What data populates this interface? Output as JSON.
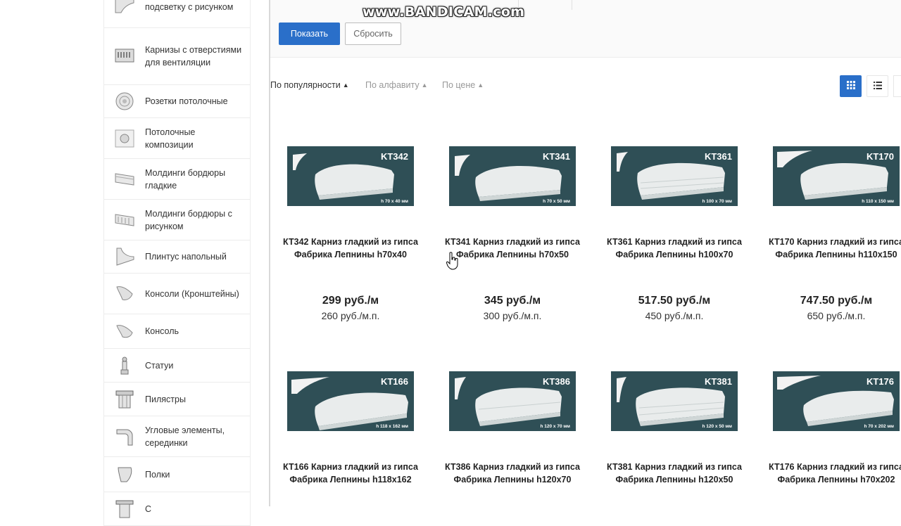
{
  "watermark": "www.BANDICAM.com",
  "sidebar": {
    "items": [
      {
        "label": "подсветку с рисунком",
        "icon": "cornice-pattern-icon"
      },
      {
        "label": "Карнизы с отверстиями для вентиляции",
        "icon": "vent-cornice-icon"
      },
      {
        "label": "Розетки потолочные",
        "icon": "ceiling-rosette-icon"
      },
      {
        "label": "Потолочные композиции",
        "icon": "ceiling-composition-icon"
      },
      {
        "label": "Молдинги бордюры гладкие",
        "icon": "molding-smooth-icon"
      },
      {
        "label": "Молдинги бордюры с рисунком",
        "icon": "molding-pattern-icon"
      },
      {
        "label": "Плинтус напольный",
        "icon": "baseboard-icon"
      },
      {
        "label": "Консоли (Кронштейны)",
        "icon": "bracket-icon"
      },
      {
        "label": "Консоль",
        "icon": "console-icon"
      },
      {
        "label": "Статуи",
        "icon": "statue-icon"
      },
      {
        "label": "Пилястры",
        "icon": "pilaster-icon"
      },
      {
        "label": "Угловые элементы, серединки",
        "icon": "corner-element-icon"
      },
      {
        "label": "Полки",
        "icon": "shelf-icon"
      },
      {
        "label": "С",
        "icon": "column-icon"
      }
    ]
  },
  "filter": {
    "show_label": "Показать",
    "reset_label": "Сбросить"
  },
  "sort": {
    "popularity": "По популярности",
    "alphabet": "По алфавиту",
    "price": "По цене",
    "active": "popularity"
  },
  "view": {
    "grid_icon": "grid-view-icon",
    "list_icon": "list-view-icon",
    "active": "grid"
  },
  "products": [
    {
      "code": "KT342",
      "dims": "h 70 x 40 мм",
      "name": "КТ342 Карниз гладкий из гипса Фабрика Лепнины h70x40",
      "price": "299 руб./м",
      "price_alt": "260 руб./м.п."
    },
    {
      "code": "KT341",
      "dims": "h 70 x 50 мм",
      "name": "КТ341 Карниз гладкий из гипса Фабрика Лепнины h70x50",
      "price": "345 руб./м",
      "price_alt": "300 руб./м.п."
    },
    {
      "code": "KT361",
      "dims": "h 100 x 70 мм",
      "name": "КТ361 Карниз гладкий из гипса Фабрика Лепнины h100x70",
      "price": "517.50 руб./м",
      "price_alt": "450 руб./м.п."
    },
    {
      "code": "KT170",
      "dims": "h 110 x 150 мм",
      "name": "КТ170 Карниз гладкий из гипса Фабрика Лепнины h110x150",
      "price": "747.50 руб./м",
      "price_alt": "650 руб./м.п."
    },
    {
      "code": "KT166",
      "dims": "h 118 x 162 мм",
      "name": "КТ166 Карниз гладкий из гипса Фабрика Лепнины h118x162",
      "price": "",
      "price_alt": ""
    },
    {
      "code": "KT386",
      "dims": "h 120 x 70 мм",
      "name": "КТ386 Карниз гладкий из гипса Фабрика Лепнины h120x70",
      "price": "",
      "price_alt": ""
    },
    {
      "code": "KT381",
      "dims": "h 120 x 50 мм",
      "name": "КТ381 Карниз гладкий из гипса Фабрика Лепнины h120x50",
      "price": "",
      "price_alt": ""
    },
    {
      "code": "KT176",
      "dims": "h 70 x 202 мм",
      "name": "КТ176 Карниз гладкий из гипса Фабрика Лепнины h70x202",
      "price": "",
      "price_alt": ""
    }
  ]
}
